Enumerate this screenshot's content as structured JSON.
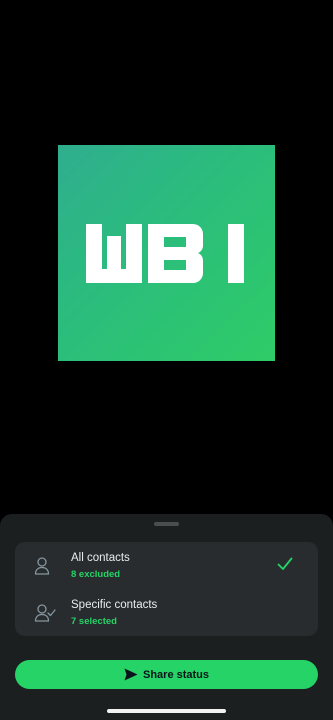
{
  "preview": {
    "logo_text": "WBI",
    "colors": {
      "gradient_start": "#2fae8f",
      "gradient_end": "#2ecc67",
      "letters": "#ffffff"
    }
  },
  "privacy_sheet": {
    "options": [
      {
        "label": "All contacts",
        "subtitle": "8 excluded",
        "icon": "person-icon",
        "selected": true
      },
      {
        "label": "Specific contacts",
        "subtitle": "7 selected",
        "icon": "person-check-icon",
        "selected": false
      }
    ],
    "share_button_label": "Share status",
    "share_icon": "send-icon",
    "colors": {
      "accent": "#25d366",
      "sheet_background": "#1c1f20",
      "card_background": "#282c2e"
    }
  }
}
